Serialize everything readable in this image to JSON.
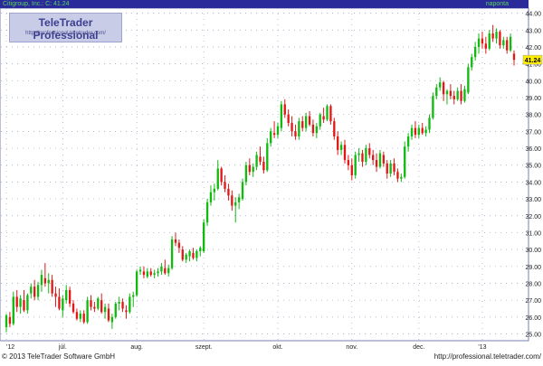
{
  "header": {
    "title": "Citigroup, Inc.: C: 41.24",
    "period": "naponta"
  },
  "logo": {
    "text": "TeleTrader Professional",
    "url": "http://professional.teletrader.com/"
  },
  "footer": {
    "copyright": "© 2013 TeleTrader Software GmbH",
    "url": "http://professional.teletrader.com/"
  },
  "colors": {
    "header_bg": "#2a2a9a",
    "header_text": "#5bd35b",
    "up": "#11b911",
    "down": "#e01818",
    "last_price_box": "#ffee00",
    "grid": "#9aa0c0"
  },
  "chart_data": {
    "type": "candlestick",
    "title": "Citigroup, Inc.: C: 41.24",
    "y_axis_side": "right",
    "ylim": [
      24.6,
      44.3
    ],
    "ytick_values": [
      25,
      26,
      27,
      28,
      29,
      30,
      31,
      32,
      33,
      34,
      35,
      36,
      37,
      38,
      39,
      40,
      41,
      42,
      43,
      44
    ],
    "ytick_labels": [
      "25.00",
      "26.00",
      "27.00",
      "28.00",
      "29.00",
      "30.00",
      "31.00",
      "32.00",
      "33.00",
      "34.00",
      "35.00",
      "36.00",
      "37.00",
      "38.00",
      "39.00",
      "40.00",
      "41.00",
      "42.00",
      "43.00",
      "44.00"
    ],
    "x_tick_labels": [
      "'12",
      "júl.",
      "aug.",
      "szept.",
      "okt.",
      "nov.",
      "dec.",
      "'13"
    ],
    "x_tick_index": [
      0,
      16,
      37,
      56,
      77,
      98,
      117,
      135
    ],
    "grid": true,
    "last_price": 41.24,
    "last_price_label": "41.24",
    "ohlc": [
      [
        25.4,
        26.2,
        25.1,
        26.1
      ],
      [
        26.0,
        26.3,
        25.4,
        25.6
      ],
      [
        25.6,
        27.5,
        25.5,
        27.2
      ],
      [
        27.2,
        27.6,
        26.3,
        26.6
      ],
      [
        26.6,
        27.3,
        26.2,
        27.1
      ],
      [
        27.0,
        27.6,
        26.3,
        26.4
      ],
      [
        26.4,
        27.4,
        26.2,
        27.3
      ],
      [
        27.4,
        28.0,
        27.1,
        27.8
      ],
      [
        27.8,
        28.2,
        27.0,
        27.2
      ],
      [
        27.2,
        28.1,
        27.0,
        27.9
      ],
      [
        27.9,
        28.8,
        27.5,
        28.5
      ],
      [
        28.3,
        29.2,
        27.8,
        28.0
      ],
      [
        28.0,
        28.6,
        27.4,
        28.2
      ],
      [
        28.2,
        28.5,
        27.2,
        27.4
      ],
      [
        27.4,
        27.8,
        26.6,
        27.2
      ],
      [
        27.2,
        27.7,
        26.4,
        26.5
      ],
      [
        26.4,
        27.3,
        26.0,
        27.1
      ],
      [
        27.0,
        27.9,
        26.8,
        27.6
      ],
      [
        27.6,
        27.8,
        26.6,
        26.8
      ],
      [
        26.8,
        27.0,
        26.2,
        26.3
      ],
      [
        26.3,
        26.5,
        25.8,
        25.9
      ],
      [
        25.9,
        26.4,
        25.7,
        26.2
      ],
      [
        26.2,
        26.4,
        25.6,
        25.7
      ],
      [
        25.7,
        27.2,
        25.6,
        27.0
      ],
      [
        27.0,
        27.3,
        26.4,
        26.6
      ],
      [
        26.6,
        26.9,
        26.3,
        26.5
      ],
      [
        26.5,
        27.2,
        26.4,
        27.1
      ],
      [
        27.0,
        27.4,
        26.2,
        26.3
      ],
      [
        26.3,
        26.8,
        25.9,
        26.6
      ],
      [
        26.5,
        26.8,
        25.7,
        25.8
      ],
      [
        25.7,
        26.2,
        25.3,
        26.0
      ],
      [
        26.0,
        26.9,
        25.9,
        26.8
      ],
      [
        26.8,
        27.2,
        26.4,
        26.9
      ],
      [
        26.9,
        27.1,
        26.3,
        26.5
      ],
      [
        26.4,
        26.7,
        25.9,
        26.3
      ],
      [
        26.3,
        27.4,
        26.2,
        27.2
      ],
      [
        27.2,
        27.5,
        26.6,
        27.3
      ],
      [
        27.3,
        28.8,
        27.2,
        28.7
      ],
      [
        28.7,
        29.0,
        28.5,
        28.8
      ],
      [
        28.7,
        29.0,
        28.3,
        28.5
      ],
      [
        28.4,
        28.9,
        28.3,
        28.7
      ],
      [
        28.7,
        28.9,
        28.4,
        28.5
      ],
      [
        28.5,
        28.8,
        28.3,
        28.6
      ],
      [
        28.6,
        28.9,
        28.4,
        28.7
      ],
      [
        28.7,
        29.2,
        28.5,
        29.0
      ],
      [
        28.9,
        29.4,
        28.5,
        28.6
      ],
      [
        28.6,
        29.1,
        28.4,
        28.9
      ],
      [
        28.9,
        30.8,
        28.8,
        30.6
      ],
      [
        30.6,
        31.0,
        30.2,
        30.4
      ],
      [
        30.4,
        30.6,
        29.8,
        30.1
      ],
      [
        30.0,
        30.2,
        29.3,
        29.4
      ],
      [
        29.4,
        29.8,
        29.2,
        29.7
      ],
      [
        29.6,
        30.0,
        29.3,
        29.9
      ],
      [
        29.8,
        30.1,
        29.4,
        29.5
      ],
      [
        29.5,
        30.0,
        29.3,
        29.9
      ],
      [
        29.9,
        30.2,
        29.6,
        30.1
      ],
      [
        29.9,
        31.8,
        29.8,
        31.6
      ],
      [
        31.6,
        33.0,
        31.4,
        32.8
      ],
      [
        32.8,
        33.8,
        32.6,
        33.4
      ],
      [
        33.4,
        33.9,
        32.9,
        33.6
      ],
      [
        33.6,
        35.3,
        33.5,
        34.8
      ],
      [
        34.8,
        34.9,
        33.8,
        34.0
      ],
      [
        34.0,
        34.4,
        33.4,
        33.6
      ],
      [
        33.6,
        33.9,
        32.9,
        33.2
      ],
      [
        33.2,
        33.5,
        32.3,
        32.6
      ],
      [
        32.6,
        33.1,
        31.6,
        32.8
      ],
      [
        32.8,
        33.3,
        32.4,
        33.1
      ],
      [
        33.0,
        34.2,
        32.9,
        34.0
      ],
      [
        34.0,
        35.2,
        33.8,
        35.0
      ],
      [
        35.0,
        35.4,
        34.4,
        34.6
      ],
      [
        34.6,
        35.1,
        34.3,
        34.9
      ],
      [
        34.9,
        35.8,
        34.7,
        35.6
      ],
      [
        35.5,
        36.1,
        35.0,
        35.2
      ],
      [
        35.2,
        35.5,
        34.5,
        34.7
      ],
      [
        34.7,
        36.6,
        34.6,
        36.3
      ],
      [
        36.3,
        37.2,
        36.1,
        37.0
      ],
      [
        36.9,
        37.6,
        36.6,
        36.8
      ],
      [
        36.8,
        37.5,
        36.6,
        37.3
      ],
      [
        37.2,
        38.8,
        37.0,
        38.6
      ],
      [
        38.6,
        38.9,
        37.8,
        38.0
      ],
      [
        38.0,
        38.3,
        37.3,
        37.5
      ],
      [
        37.5,
        37.9,
        36.7,
        37.0
      ],
      [
        37.0,
        37.4,
        36.5,
        36.7
      ],
      [
        36.7,
        37.8,
        36.5,
        37.6
      ],
      [
        37.6,
        37.9,
        37.0,
        37.2
      ],
      [
        37.2,
        38.1,
        37.0,
        37.9
      ],
      [
        37.9,
        38.2,
        37.3,
        37.4
      ],
      [
        37.4,
        37.7,
        36.7,
        36.9
      ],
      [
        36.9,
        37.5,
        36.6,
        37.3
      ],
      [
        37.3,
        38.1,
        37.1,
        38.0
      ],
      [
        37.9,
        38.4,
        37.5,
        37.7
      ],
      [
        37.7,
        38.6,
        37.6,
        38.5
      ],
      [
        38.5,
        38.6,
        37.4,
        37.6
      ],
      [
        37.6,
        37.8,
        36.5,
        36.7
      ],
      [
        36.7,
        37.0,
        35.6,
        35.9
      ],
      [
        35.9,
        36.4,
        35.6,
        36.2
      ],
      [
        36.2,
        36.5,
        35.1,
        35.3
      ],
      [
        35.3,
        35.6,
        34.7,
        35.0
      ],
      [
        35.0,
        35.4,
        34.1,
        34.4
      ],
      [
        34.4,
        35.8,
        34.2,
        35.6
      ],
      [
        35.6,
        36.0,
        35.2,
        35.7
      ],
      [
        35.7,
        35.9,
        34.9,
        35.2
      ],
      [
        35.2,
        36.2,
        35.0,
        36.0
      ],
      [
        36.0,
        36.3,
        35.4,
        35.6
      ],
      [
        35.6,
        35.9,
        35.0,
        35.3
      ],
      [
        35.3,
        35.7,
        34.6,
        34.9
      ],
      [
        34.9,
        35.9,
        34.8,
        35.7
      ],
      [
        35.6,
        35.8,
        34.9,
        35.1
      ],
      [
        35.1,
        35.3,
        34.2,
        34.5
      ],
      [
        34.5,
        35.3,
        34.3,
        35.1
      ],
      [
        35.1,
        35.4,
        34.4,
        34.6
      ],
      [
        34.6,
        34.8,
        34.0,
        34.2
      ],
      [
        34.2,
        34.5,
        34.0,
        34.3
      ],
      [
        34.3,
        36.4,
        34.2,
        36.1
      ],
      [
        36.1,
        36.9,
        35.8,
        36.7
      ],
      [
        36.7,
        37.4,
        36.5,
        37.2
      ],
      [
        37.2,
        37.6,
        36.6,
        36.8
      ],
      [
        36.8,
        37.4,
        36.6,
        37.2
      ],
      [
        37.2,
        37.5,
        36.8,
        36.9
      ],
      [
        36.9,
        37.3,
        36.7,
        37.1
      ],
      [
        37.1,
        38.0,
        36.9,
        37.8
      ],
      [
        37.8,
        39.3,
        37.7,
        39.1
      ],
      [
        39.1,
        39.8,
        38.9,
        39.6
      ],
      [
        39.6,
        40.2,
        39.4,
        39.9
      ],
      [
        39.9,
        40.0,
        38.8,
        39.2
      ],
      [
        39.2,
        39.5,
        38.6,
        39.4
      ],
      [
        39.4,
        39.8,
        38.9,
        39.1
      ],
      [
        39.1,
        39.4,
        38.6,
        38.9
      ],
      [
        38.9,
        39.6,
        38.8,
        39.4
      ],
      [
        39.4,
        39.8,
        38.6,
        38.8
      ],
      [
        38.8,
        39.7,
        38.7,
        39.5
      ],
      [
        39.3,
        41.0,
        39.2,
        40.8
      ],
      [
        40.8,
        41.6,
        40.6,
        41.4
      ],
      [
        41.4,
        42.3,
        41.2,
        42.0
      ],
      [
        42.0,
        42.8,
        41.6,
        42.5
      ],
      [
        42.5,
        42.9,
        41.9,
        42.2
      ],
      [
        42.2,
        42.6,
        41.6,
        41.9
      ],
      [
        41.9,
        43.0,
        41.8,
        42.8
      ],
      [
        42.8,
        43.3,
        42.3,
        42.5
      ],
      [
        42.5,
        43.1,
        42.2,
        42.9
      ],
      [
        42.9,
        43.0,
        41.9,
        42.1
      ],
      [
        42.1,
        42.6,
        41.9,
        42.4
      ],
      [
        42.4,
        42.6,
        41.6,
        41.8
      ],
      [
        41.8,
        42.8,
        41.7,
        42.6
      ],
      [
        41.6,
        41.8,
        40.9,
        41.24
      ]
    ]
  }
}
